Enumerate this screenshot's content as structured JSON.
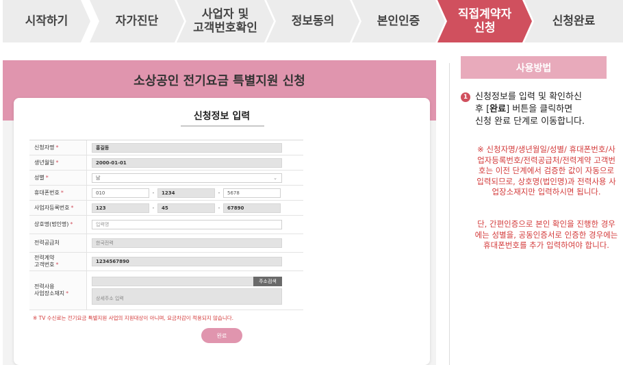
{
  "steps": [
    {
      "line1": "시작하기",
      "line2": ""
    },
    {
      "line1": "자가진단",
      "line2": ""
    },
    {
      "line1": "사업자 및",
      "line2": "고객번호확인"
    },
    {
      "line1": "정보동의",
      "line2": ""
    },
    {
      "line1": "본인인증",
      "line2": ""
    },
    {
      "line1": "직접계약자",
      "line2": "신청"
    },
    {
      "line1": "신청완료",
      "line2": ""
    }
  ],
  "panel": {
    "title": "소상공인 전기요금 특별지원 신청",
    "card_title": "신청정보 입력"
  },
  "required_mark": "*",
  "form": {
    "applicant_name": {
      "label": "신청자명",
      "value": "홍길동"
    },
    "birth_date": {
      "label": "생년월일",
      "value": "2000-01-01"
    },
    "gender": {
      "label": "성별",
      "value": "남"
    },
    "phone": {
      "label": "휴대폰번호",
      "part1": "010",
      "part2": "1234",
      "part3": "5678",
      "sep": "-"
    },
    "business_number": {
      "label": "사업자등록번호",
      "part1": "123",
      "part2": "45",
      "part3": "67890",
      "sep": "-"
    },
    "company_name": {
      "label": "상호명(법인명)",
      "placeholder": "입력명"
    },
    "power_supplier": {
      "label": "전력공급처",
      "placeholder": "한국전력"
    },
    "customer_number": {
      "label_line1": "전력계약",
      "label_line2": "고객번호",
      "value": "1234567890"
    },
    "business_address": {
      "label_line1": "전력사용",
      "label_line2": "사업장소재지",
      "search_button": "주소검색",
      "detail_placeholder": "상세주소 입력"
    }
  },
  "notice": "※ TV 수신료는 전기요금 특별지원 사업의 지원대상이 아니며, 요금차감이 적용되지 않습니다.",
  "submit_label": "완료",
  "help": {
    "title": "사용방법",
    "step_number": "1",
    "step_line1": "신청정보를 입력 및 확인하신",
    "step_line2_pre": "후 [",
    "step_line2_bold": "완료",
    "step_line2_post": "] 버튼을 클릭하면",
    "step_line3": "신청 완료 단계로 이동합니다.",
    "note1": "※ 신청자명/생년월일/성별/ 휴대폰번호/사업자등록번호/전력공급처/전력계약 고객번호는 이전 단계에서 검증한 값이 자동으로 입력되므로, 상호명(법인명)과 전력사용 사업장소재지만 입력하시면 됩니다.",
    "note2": "단, 간편인증으로 본인 확인을 진행한 경우에는 성별을, 공동인증서로 인증한 경우에는 휴대폰번호를 추가 입력하여야 합니다."
  },
  "colors": {
    "accent": "#d0505e",
    "pink": "#e095ae",
    "help_head": "#e8aabb",
    "notice": "#d33a3a"
  }
}
